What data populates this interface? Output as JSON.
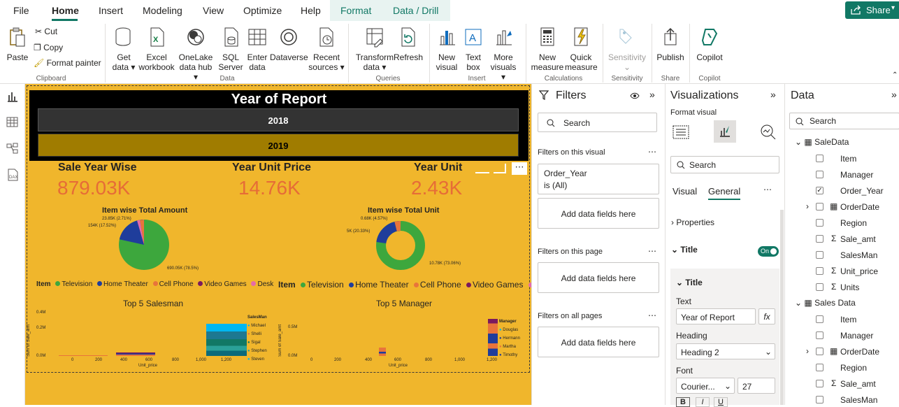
{
  "menu": {
    "items": [
      "File",
      "Home",
      "Insert",
      "Modeling",
      "View",
      "Optimize",
      "Help",
      "Format",
      "Data / Drill"
    ],
    "share": "Share"
  },
  "ribbon": {
    "paste": "Paste",
    "cut": "Cut",
    "copy": "Copy",
    "format_painter": "Format painter",
    "clipboard": "Clipboard",
    "get_data": "Get",
    "get_data2": "data",
    "excel": "Excel",
    "excel2": "workbook",
    "onelake": "OneLake",
    "onelake2": "data hub",
    "sql": "SQL",
    "sql2": "Server",
    "enter": "Enter",
    "enter2": "data",
    "dataverse": "Dataverse",
    "recent": "Recent",
    "recent2": "sources",
    "data_group": "Data",
    "transform": "Transform",
    "transform2": "data",
    "refresh": "Refresh",
    "queries": "Queries",
    "new_visual": "New",
    "new_visual2": "visual",
    "textbox": "Text",
    "textbox2": "box",
    "more": "More",
    "more2": "visuals",
    "insert": "Insert",
    "new_measure": "New",
    "new_measure2": "measure",
    "quick": "Quick",
    "quick2": "measure",
    "calculations": "Calculations",
    "sensitivity": "Sensitivity",
    "sensitivity_group": "Sensitivity",
    "publish": "Publish",
    "share_group": "Share",
    "copilot": "Copilot",
    "copilot_group": "Copilot"
  },
  "report": {
    "slicer_title": "Year of Report",
    "years": [
      "2018",
      "2019"
    ],
    "kpis": [
      {
        "label": "Sale Year Wise",
        "value": "879.03K"
      },
      {
        "label": "Year Unit Price",
        "value": "14.76K"
      },
      {
        "label": "Year Unit",
        "value": "2.43K"
      }
    ],
    "pie1": {
      "title": "Item wise Total Amount",
      "labels": [
        "23.85K (2.71%)",
        "154K (17.52%)",
        "690.05K (78.5%)"
      ]
    },
    "pie2": {
      "title": "Item wise Total Unit",
      "labels": [
        "0.68K (4.57%)",
        "5K (20.33%)",
        "10.78K (73.06%)"
      ]
    },
    "legend": {
      "title": "Item",
      "items": [
        "Television",
        "Home Theater",
        "Cell Phone",
        "Video Games",
        "Desk"
      ]
    },
    "chart3": {
      "title": "Top 5 Salesman",
      "ylabel": "Sum of Sale_amt",
      "xlabel": "Unit_price",
      "yticks": [
        "0.4M",
        "0.2M",
        "0.0M"
      ],
      "xticks": [
        "0",
        "200",
        "400",
        "600",
        "800",
        "1,000",
        "1,200"
      ],
      "legend_title": "SalesMan",
      "legend": [
        "Michael",
        "Shelli",
        "Sigal",
        "Stephen",
        "Steven"
      ]
    },
    "chart4": {
      "title": "Top 5 Manager",
      "ylabel": "Sum of Sale_amt",
      "xlabel": "Unit_price",
      "yticks": [
        "0.5M",
        "0.0M"
      ],
      "xticks": [
        "0",
        "200",
        "400",
        "600",
        "800",
        "1,000",
        "1,200"
      ],
      "legend_title": "Manager",
      "legend": [
        "Douglas",
        "Hermann",
        "Martha",
        "Timothy"
      ]
    }
  },
  "filters": {
    "title": "Filters",
    "search": "Search",
    "on_visual": "Filters on this visual",
    "field": "Order_Year",
    "field_state": "is (All)",
    "add": "Add data fields here",
    "on_page": "Filters on this page",
    "on_all": "Filters on all pages"
  },
  "viz": {
    "title": "Visualizations",
    "format_visual": "Format visual",
    "search": "Search",
    "tab_visual": "Visual",
    "tab_general": "General",
    "properties": "Properties",
    "title_section": "Title",
    "toggle": "On",
    "title_sub": "Title",
    "text_label": "Text",
    "text_value": "Year of Report",
    "fx": "fx",
    "heading_label": "Heading",
    "heading_value": "Heading 2",
    "font_label": "Font",
    "font_value": "Courier...",
    "font_size": "27"
  },
  "data": {
    "title": "Data",
    "search": "Search",
    "tables": [
      {
        "name": "SaleData",
        "fields": [
          {
            "name": "Item",
            "sigma": false,
            "checked": false
          },
          {
            "name": "Manager",
            "sigma": false,
            "checked": false
          },
          {
            "name": "Order_Year",
            "sigma": false,
            "checked": true
          },
          {
            "name": "OrderDate",
            "sigma": false,
            "checked": false,
            "hier": true
          },
          {
            "name": "Region",
            "sigma": false,
            "checked": false
          },
          {
            "name": "Sale_amt",
            "sigma": true,
            "checked": false
          },
          {
            "name": "SalesMan",
            "sigma": false,
            "checked": false
          },
          {
            "name": "Unit_price",
            "sigma": true,
            "checked": false
          },
          {
            "name": "Units",
            "sigma": true,
            "checked": false
          }
        ]
      },
      {
        "name": "Sales Data",
        "fields": [
          {
            "name": "Item",
            "sigma": false,
            "checked": false
          },
          {
            "name": "Manager",
            "sigma": false,
            "checked": false
          },
          {
            "name": "OrderDate",
            "sigma": false,
            "checked": false,
            "hier": true
          },
          {
            "name": "Region",
            "sigma": false,
            "checked": false
          },
          {
            "name": "Sale_amt",
            "sigma": true,
            "checked": false
          },
          {
            "name": "SalesMan",
            "sigma": false,
            "checked": false
          }
        ]
      }
    ]
  },
  "colors": {
    "accent": "#117865",
    "canvas": "#f0b62c",
    "kpi": "#e66c37",
    "television": "#3da73d",
    "home_theater": "#1f3d9b",
    "cell_phone": "#e8743b",
    "video_games": "#7a1a5e",
    "desk": "#e56ba9"
  }
}
